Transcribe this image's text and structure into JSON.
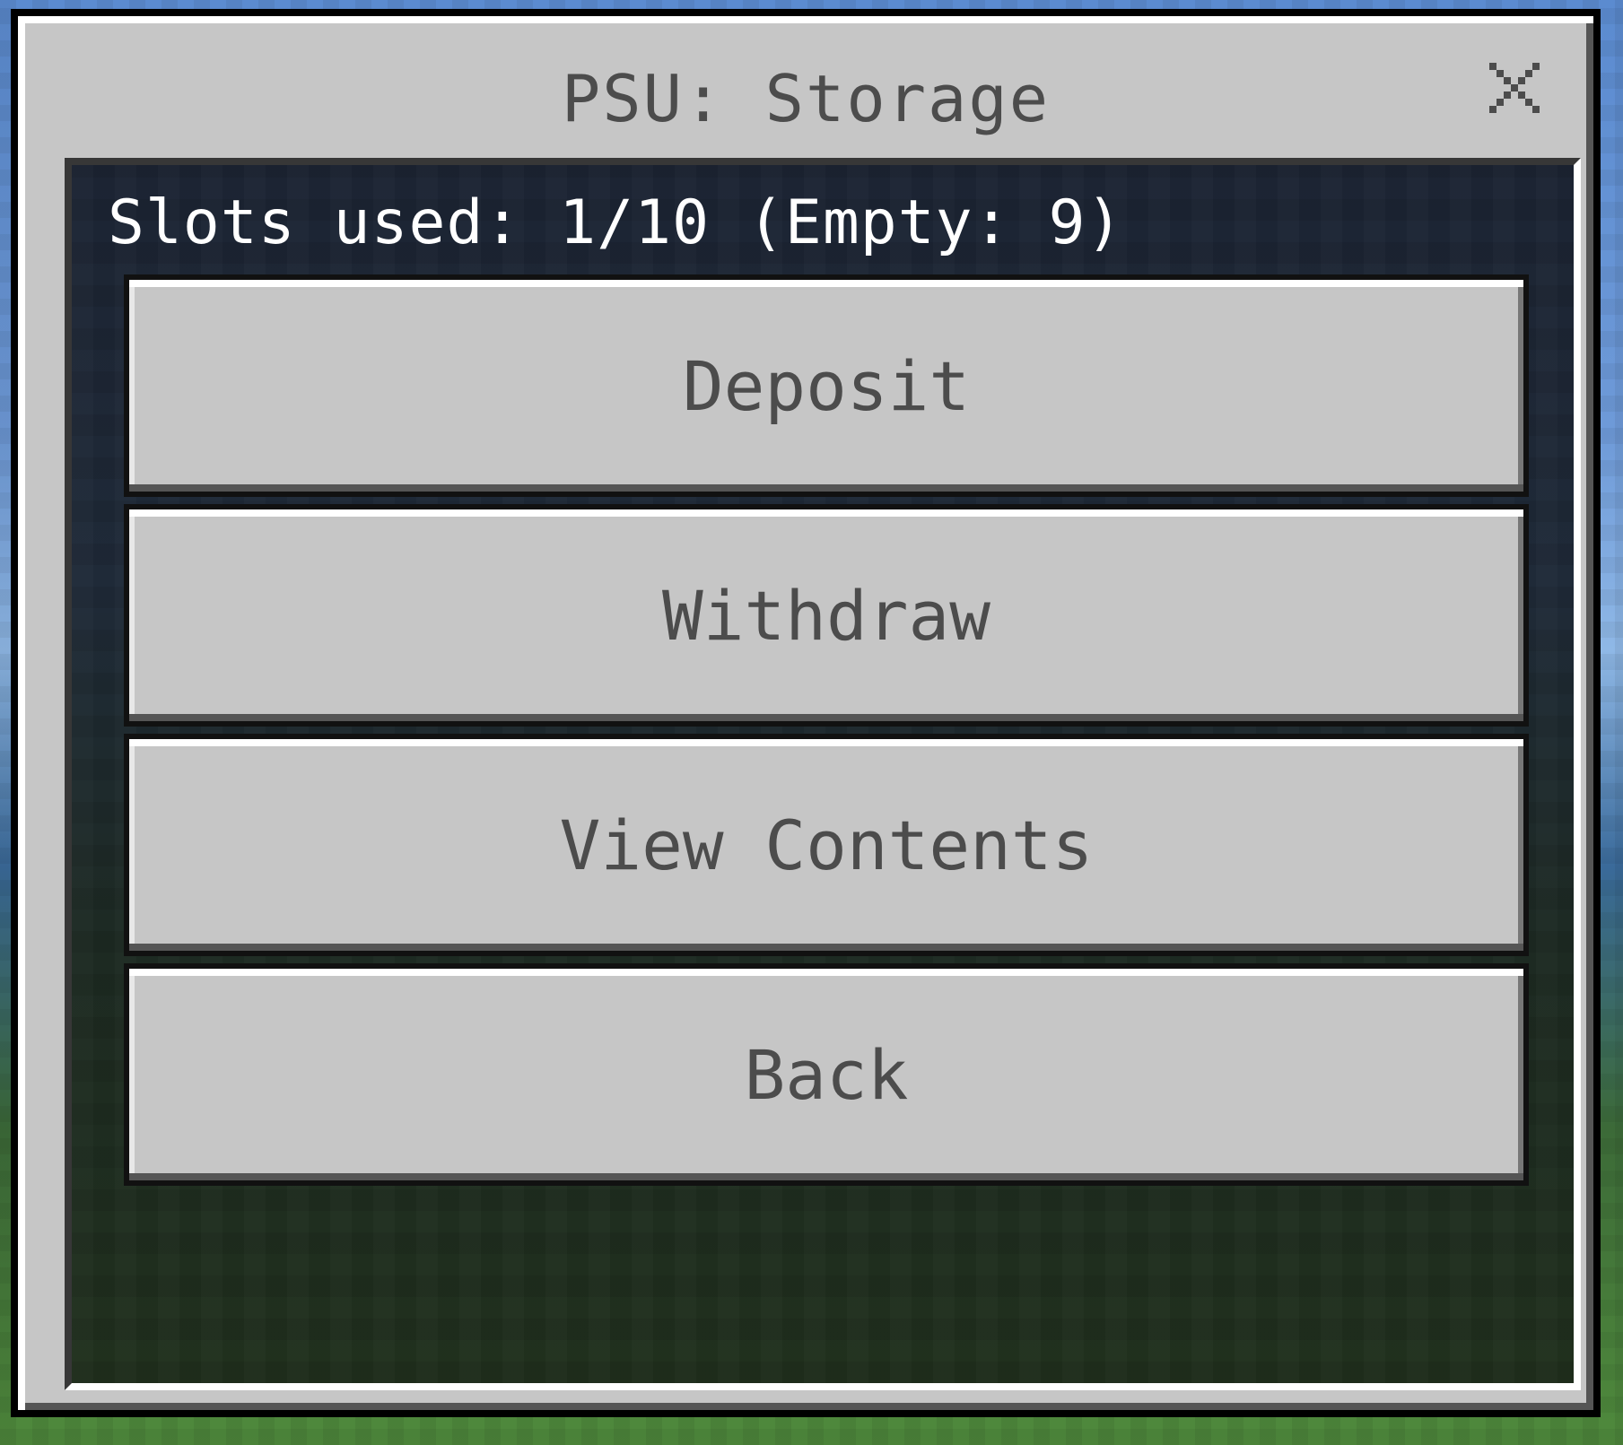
{
  "dialog": {
    "title": "PSU: Storage",
    "close_icon": "close-icon"
  },
  "status": {
    "slots_text": "Slots used: 1/10 (Empty: 9)",
    "slots_used": 1,
    "slots_total": 10,
    "slots_empty": 9
  },
  "buttons": [
    {
      "label": "Deposit"
    },
    {
      "label": "Withdraw"
    },
    {
      "label": "View Contents"
    },
    {
      "label": "Back"
    }
  ],
  "colors": {
    "panel": "#c6c6c6",
    "text": "#4c4c4c",
    "content_bg": "#1f2a38"
  }
}
